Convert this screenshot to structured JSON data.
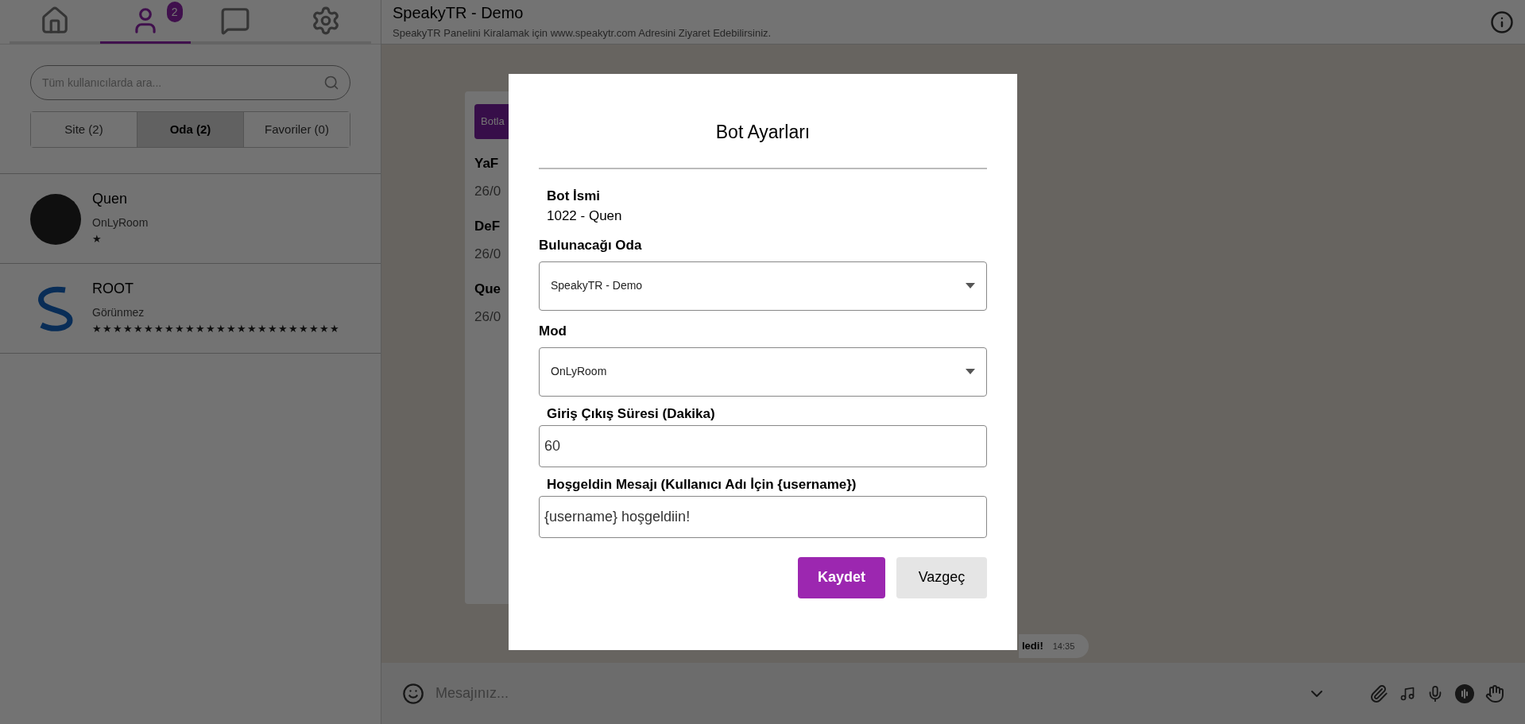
{
  "sidebar": {
    "nav_tabs": [
      {
        "selected": false
      },
      {
        "selected": true,
        "badge": "2"
      },
      {
        "selected": false
      },
      {
        "selected": false
      }
    ],
    "search": {
      "placeholder": "Tüm kullanıcılarda ara..."
    },
    "filter_tabs": [
      {
        "label": "Site (2)",
        "selected": false
      },
      {
        "label": "Oda (2)",
        "selected": true
      },
      {
        "label": "Favoriler (0)",
        "selected": false
      }
    ],
    "users": [
      {
        "name": "Quen",
        "status": "OnLyRoom",
        "rank": "★",
        "kind": "photo"
      },
      {
        "name": "ROOT",
        "status": "Görünmez",
        "rank": "★★★★★★★★★★★★★★★★★★★★★★★★",
        "kind": "logo"
      }
    ]
  },
  "header": {
    "title": "SpeakyTR - Demo",
    "subtitle": "SpeakyTR Panelini Kiralamak için www.speakytr.com Adresini Ziyaret Edebilirsiniz."
  },
  "background_card": {
    "button": "Botla",
    "rows": [
      {
        "title": "YaF",
        "date": "26/0"
      },
      {
        "title": "DeF",
        "date": "26/0"
      },
      {
        "title": "Que",
        "date": "26/0"
      }
    ]
  },
  "message_bubble": {
    "text": "ledi!",
    "time": "14:35"
  },
  "composer": {
    "placeholder": "Mesajınız..."
  },
  "dialog": {
    "title": "Bot Ayarları",
    "name_label": "Bot İsmi",
    "name_value": "1022 - Quen",
    "fields": [
      {
        "kind": "select",
        "label": "Bulunacağı Oda",
        "value": "SpeakyTR - Demo"
      },
      {
        "kind": "select",
        "label": "Mod",
        "value": "OnLyRoom"
      },
      {
        "kind": "input",
        "label": "Giriş Çıkış Süresi (Dakika)",
        "value": "60"
      },
      {
        "kind": "input",
        "label": "Hoşgeldin Mesajı (Kullanıcı Adı İçin {username})",
        "value": "{username} hoşgeldiin!"
      }
    ],
    "buttons": [
      {
        "kind": "primary",
        "label": "Kaydet"
      },
      {
        "kind": "secondary",
        "label": "Vazgeç"
      }
    ]
  }
}
